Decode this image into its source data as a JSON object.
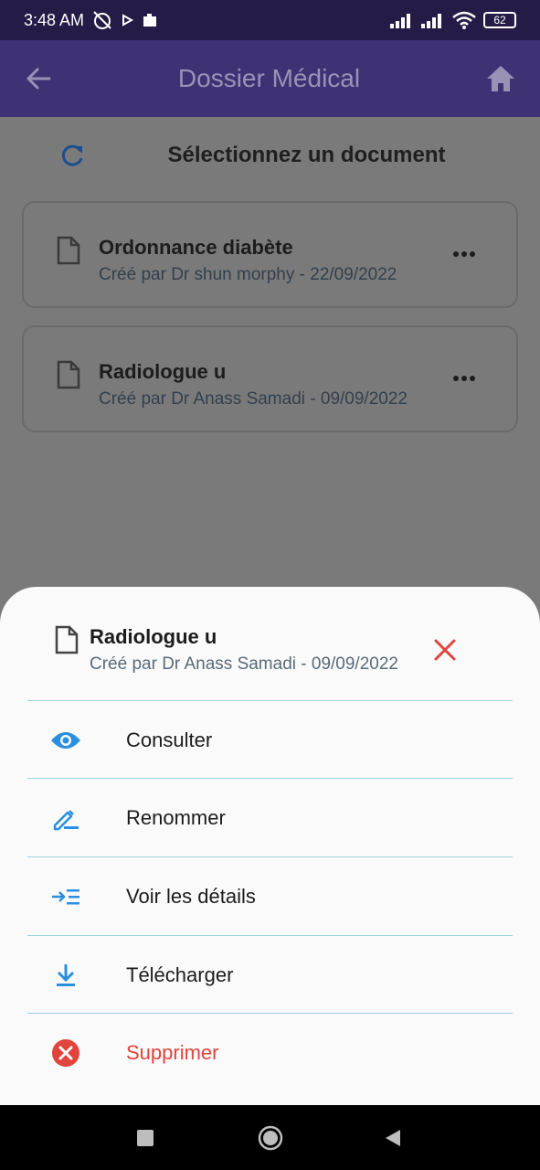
{
  "status_bar": {
    "time": "3:48 AM",
    "battery": "62"
  },
  "app_bar": {
    "title": "Dossier Médical"
  },
  "page": {
    "title": "Sélectionnez un document"
  },
  "documents": [
    {
      "name": "Ordonnance diabète",
      "meta": "Créé par Dr shun morphy - 22/09/2022"
    },
    {
      "name": "Radiologue u",
      "meta": "Créé par Dr Anass Samadi - 09/09/2022"
    }
  ],
  "sheet": {
    "document_name": "Radiologue u",
    "document_meta": "Créé par Dr Anass Samadi - 09/09/2022",
    "options": [
      {
        "label": "Consulter",
        "icon": "eye-icon"
      },
      {
        "label": "Renommer",
        "icon": "pencil-icon"
      },
      {
        "label": "Voir les détails",
        "icon": "details-icon"
      },
      {
        "label": "Télécharger",
        "icon": "download-icon"
      },
      {
        "label": "Supprimer",
        "icon": "delete-circle-icon"
      }
    ]
  },
  "colors": {
    "status_bar": "#241c46",
    "app_bar": "#3e3275",
    "accent_blue": "#2a8fe0",
    "danger_red": "#e0443c"
  }
}
